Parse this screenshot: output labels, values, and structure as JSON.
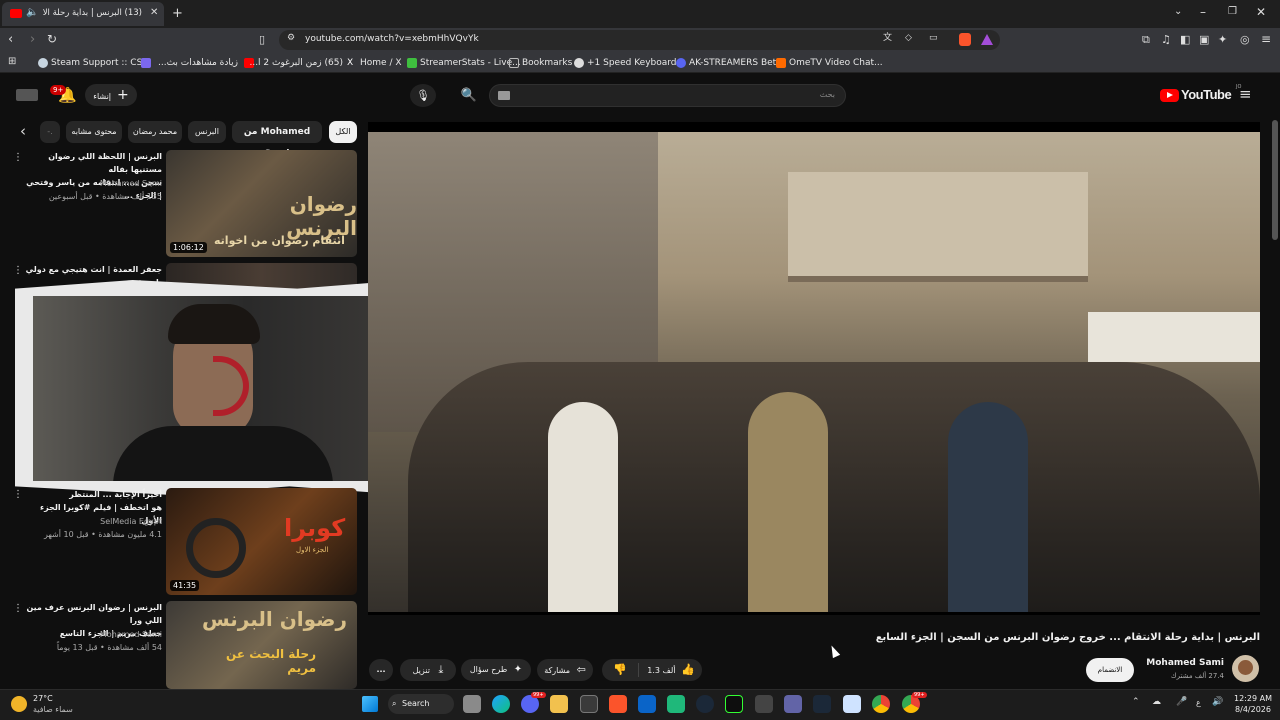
{
  "browser": {
    "tab_title": "(13) البرنس | بداية رحلة الانتقا...",
    "new_tab_icon": "plus-icon",
    "url": "youtube.com/watch?v=xebmHhVQvYk",
    "bookmarks": [
      {
        "label": "Steam Support :: CS...",
        "color": "#c7d5e0"
      },
      {
        "label": "زيادة مشاهدات بث...",
        "color": "#7b68ee"
      },
      {
        "label": "(65) زمن البرغوث 2 ا...",
        "color": "#ff0000"
      },
      {
        "label": "Home / X",
        "color": "#ffffff"
      },
      {
        "label": "StreamerStats - Live...",
        "color": "#3fbf3f"
      },
      {
        "label": "Bookmarks",
        "color": "#bbbbbb"
      },
      {
        "label": "+1 Speed Keyboard...",
        "color": "#dddddd"
      },
      {
        "label": "AK-STREAMERS Beta",
        "color": "#5865f2"
      },
      {
        "label": "OmeTV Video Chat...",
        "color": "#ff6a00"
      }
    ]
  },
  "youtube": {
    "logo_text": "YouTube",
    "logo_superscript": "JO",
    "search_placeholder": "بحث",
    "create_label": "إنشاء",
    "notification_count": "9+",
    "chips": [
      "الكل",
      "من Mohamed Sami",
      "البرنس",
      "محمد رمضان",
      "محتوى مشابه"
    ],
    "player": {
      "scene": "Street crowd scene",
      "overlay": "Streamer webcam overlay"
    },
    "video_title": "البرنس | بداية رحلة الانتقام ... خروج رضوان البرنس من السجن | الجزء السابع",
    "channel": {
      "name": "Mohamed Sami",
      "subscribers": "27.4 ألف مشترك",
      "join_label": "الانضمام"
    },
    "actions": {
      "likes": "1.3 ألف",
      "share": "مشاركة",
      "ask": "طرح سؤال",
      "download": "تنزيل",
      "more": "..."
    },
    "related": [
      {
        "title_line1": "البرنس | اللحظة اللي رضوان مستنيها بفاله",
        "title_line2": "سجن ..... انتقامه من ياسر وفتحي | الجزء ...",
        "channel": "Mohamed Sami",
        "meta": "135 ألف مشاهدة • قبل أسبوعين",
        "duration": "1:06:12",
        "thumb_text": "رضوان البرنس",
        "thumb_sub": "انتقام رضوان من اخواته"
      },
      {
        "title_line1": "جعفر العمدة | انت هتيجي مع دولي يا جعفر",
        "title_line2": "",
        "channel": "",
        "meta": "",
        "duration": "",
        "thumb_text": "",
        "thumb_sub": ""
      },
      {
        "title_line1": "أخيراً الإجابة ... المنتظر",
        "title_line2": "هو اتخطف | فيلم #كوبرا الجزء الأول",
        "channel": "SelMedia Egypt",
        "meta": "4.1 مليون مشاهدة • قبل 10 أشهر",
        "duration": "41:35",
        "thumb_text": "كوبرا",
        "thumb_sub": "الجزء الاول"
      },
      {
        "title_line1": "البرنس | رضوان البرنس عرف مين اللي ورا",
        "title_line2": "خطف مريم | الجزء التاسع",
        "channel": "Mohamed Sami",
        "meta": "54 ألف مشاهدة • قبل 13 يوماً",
        "duration": "",
        "thumb_text": "رضوان البرنس",
        "thumb_sub": "رحلة البحث عن مريم"
      }
    ]
  },
  "taskbar": {
    "weather_temp": "27°C",
    "weather_desc": "سماء صافية",
    "search_label": "Search",
    "time": "12:29 AM",
    "date": "8/4/2026",
    "badges": [
      "99+",
      "99+",
      "99+"
    ]
  },
  "colors": {
    "yt_red": "#ff0000",
    "bg": "#0f0f0f",
    "chip": "#272727"
  }
}
